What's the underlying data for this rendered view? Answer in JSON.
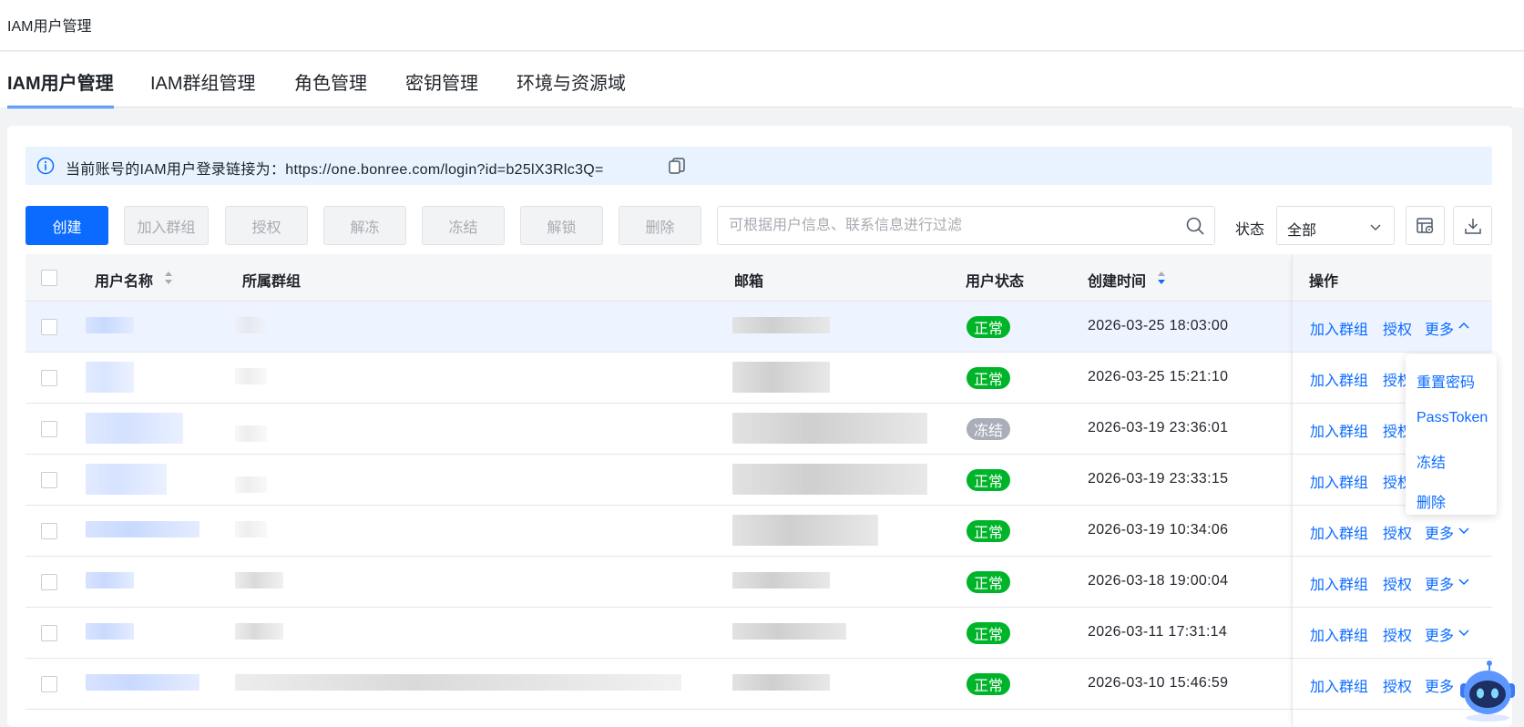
{
  "topbar": {
    "title": "IAM用户管理"
  },
  "tabs": [
    {
      "label": "IAM用户管理",
      "active": true
    },
    {
      "label": "IAM群组管理"
    },
    {
      "label": "角色管理"
    },
    {
      "label": "密钥管理"
    },
    {
      "label": "环境与资源域"
    }
  ],
  "notice": {
    "text": "当前账号的IAM用户登录链接为：https://one.bonree.com/login?id=b25lX3Rlc3Q="
  },
  "toolbar": {
    "create": "创建",
    "add_group": "加入群组",
    "authorize": "授权",
    "unfreeze": "解冻",
    "freeze": "冻结",
    "unlock": "解锁",
    "delete": "删除",
    "search_placeholder": "可根据用户信息、联系信息进行过滤",
    "status_label": "状态",
    "status_value": "全部"
  },
  "table": {
    "headers": {
      "username": "用户名称",
      "group": "所属群组",
      "email": "邮箱",
      "status": "用户状态",
      "created": "创建时间",
      "ops": "操作"
    },
    "rows": [
      {
        "status": "正常",
        "created": "2026-03-25 18:03:00",
        "more_open": true
      },
      {
        "status": "正常",
        "created": "2026-03-25 15:21:10"
      },
      {
        "status": "冻结",
        "created": "2026-03-19 23:36:01"
      },
      {
        "status": "正常",
        "created": "2026-03-19 23:33:15"
      },
      {
        "status": "正常",
        "created": "2026-03-19 10:34:06"
      },
      {
        "status": "正常",
        "created": "2026-03-18 19:00:04"
      },
      {
        "status": "正常",
        "created": "2026-03-11 17:31:14"
      },
      {
        "status": "正常",
        "created": "2026-03-10 15:46:59"
      }
    ],
    "ops": {
      "add_group": "加入群组",
      "authorize": "授权",
      "more": "更多"
    }
  },
  "more_menu": [
    "重置密码",
    "PassToken",
    "冻结",
    "删除"
  ],
  "colors": {
    "primary": "#0b6bff",
    "ok": "#00b42a",
    "frozen": "#a9aeb8"
  }
}
